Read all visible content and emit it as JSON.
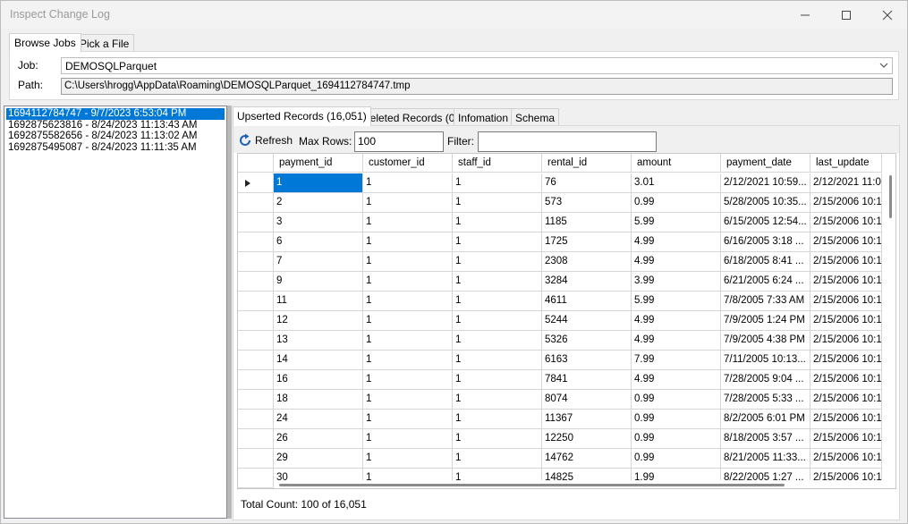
{
  "window": {
    "title": "Inspect Change Log"
  },
  "top_tabs": [
    "Browse Jobs",
    "Pick a File"
  ],
  "job": {
    "label": "Job:",
    "value": "DEMOSQLParquet"
  },
  "path": {
    "label": "Path:",
    "value": "C:\\Users\\hrogg\\AppData\\Roaming\\DEMOSQLParquet_1694112784747.tmp"
  },
  "jobs_list": [
    "1694112784747 - 9/7/2023 6:53:04 PM",
    "1692875623816 - 8/24/2023 11:13:43 AM",
    "1692875582656 - 8/24/2023 11:13:02 AM",
    "1692875495087 - 8/24/2023 11:11:35 AM"
  ],
  "right_tabs": [
    "Upserted Records (16,051)",
    "Deleted Records (0)",
    "Infomation",
    "Schema"
  ],
  "toolbar": {
    "refresh_label": "Refresh",
    "max_rows_label": "Max Rows:",
    "max_rows_value": "100",
    "filter_label": "Filter:",
    "filter_value": ""
  },
  "grid": {
    "columns": [
      "payment_id",
      "customer_id",
      "staff_id",
      "rental_id",
      "amount",
      "payment_date",
      "last_update"
    ],
    "rows": [
      [
        "1",
        "1",
        "1",
        "76",
        "3.01",
        "2/12/2021 10:59...",
        "2/12/2021 11:0"
      ],
      [
        "2",
        "1",
        "1",
        "573",
        "0.99",
        "5/28/2005 10:35...",
        "2/15/2006 10:1"
      ],
      [
        "3",
        "1",
        "1",
        "1185",
        "5.99",
        "6/15/2005 12:54...",
        "2/15/2006 10:1"
      ],
      [
        "6",
        "1",
        "1",
        "1725",
        "4.99",
        "6/16/2005 3:18 ...",
        "2/15/2006 10:1"
      ],
      [
        "7",
        "1",
        "1",
        "2308",
        "4.99",
        "6/18/2005 8:41 ...",
        "2/15/2006 10:1"
      ],
      [
        "9",
        "1",
        "1",
        "3284",
        "3.99",
        "6/21/2005 6:24 ...",
        "2/15/2006 10:1"
      ],
      [
        "11",
        "1",
        "1",
        "4611",
        "5.99",
        "7/8/2005 7:33 AM",
        "2/15/2006 10:1"
      ],
      [
        "12",
        "1",
        "1",
        "5244",
        "4.99",
        "7/9/2005 1:24 PM",
        "2/15/2006 10:1"
      ],
      [
        "13",
        "1",
        "1",
        "5326",
        "4.99",
        "7/9/2005 4:38 PM",
        "2/15/2006 10:1"
      ],
      [
        "14",
        "1",
        "1",
        "6163",
        "7.99",
        "7/11/2005 10:13...",
        "2/15/2006 10:1"
      ],
      [
        "16",
        "1",
        "1",
        "7841",
        "4.99",
        "7/28/2005 9:04 ...",
        "2/15/2006 10:1"
      ],
      [
        "18",
        "1",
        "1",
        "8074",
        "0.99",
        "7/28/2005 5:33 ...",
        "2/15/2006 10:1"
      ],
      [
        "24",
        "1",
        "1",
        "11367",
        "0.99",
        "8/2/2005 6:01 PM",
        "2/15/2006 10:1"
      ],
      [
        "26",
        "1",
        "1",
        "12250",
        "0.99",
        "8/18/2005 3:57 ...",
        "2/15/2006 10:1"
      ],
      [
        "29",
        "1",
        "1",
        "14762",
        "0.99",
        "8/21/2005 11:33...",
        "2/15/2006 10:1"
      ],
      [
        "30",
        "1",
        "1",
        "14825",
        "1.99",
        "8/22/2005 1:27 ...",
        "2/15/2006 10:1"
      ]
    ]
  },
  "status": {
    "total_count": "Total Count: 100 of 16,051"
  },
  "colors": {
    "selection": "#0078d7",
    "refresh_icon": "#1a5fb4"
  },
  "icons": [
    "minimize-icon",
    "maximize-icon",
    "close-icon",
    "chevron-down-icon",
    "refresh-icon",
    "current-row-icon"
  ]
}
